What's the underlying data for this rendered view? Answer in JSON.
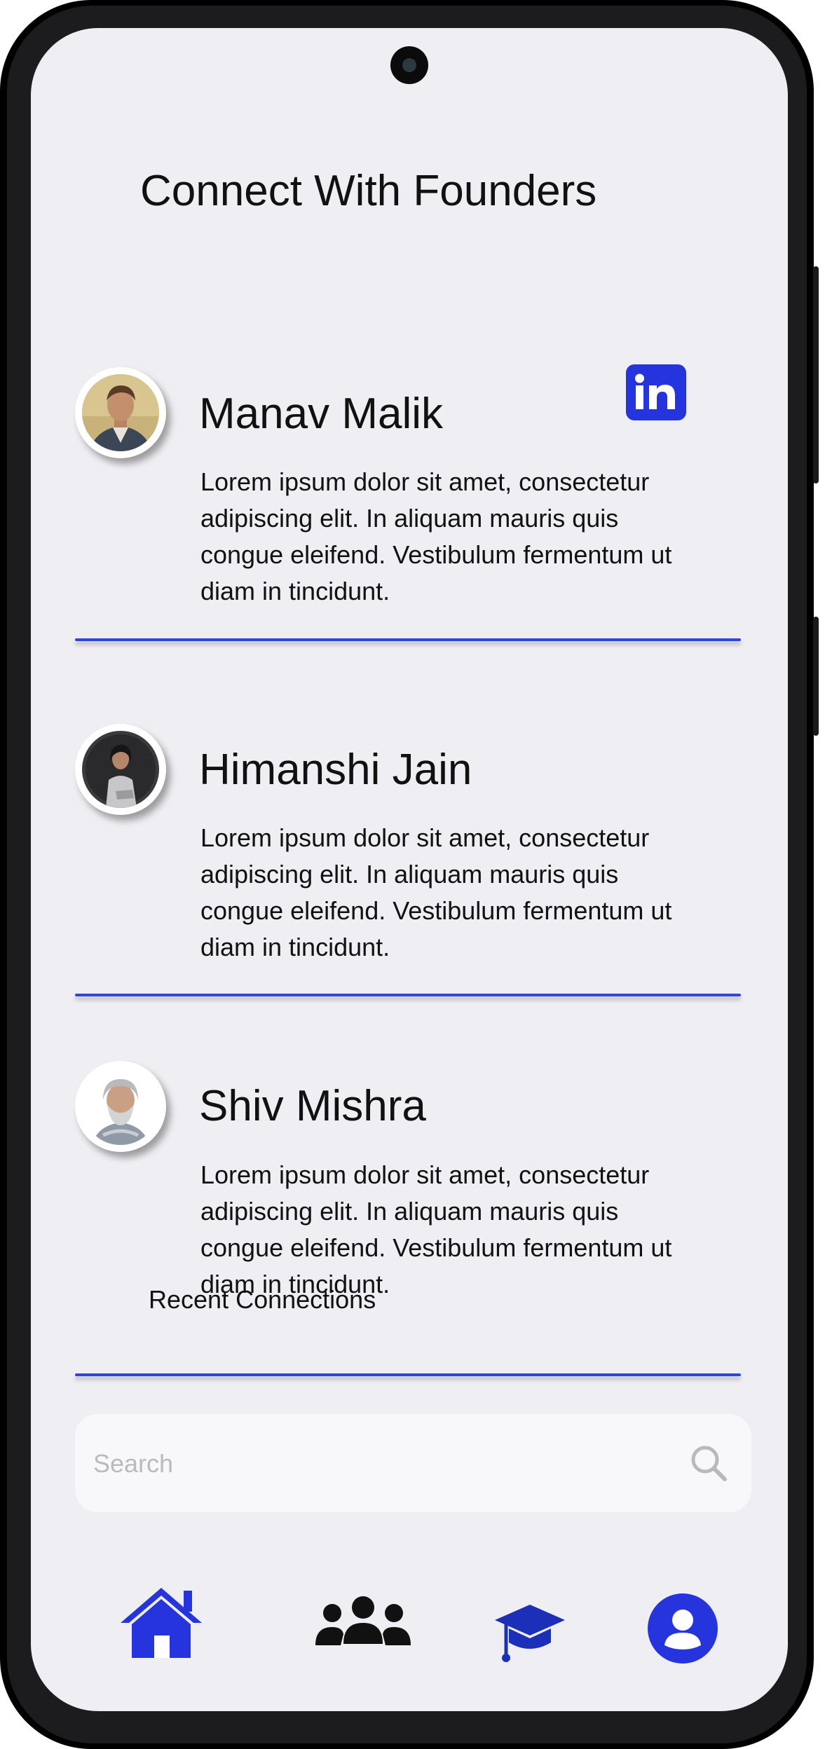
{
  "header": {
    "title": "Connect With Founders"
  },
  "founders": [
    {
      "name": "Manav Malik",
      "bio": "Lorem ipsum dolor sit amet, consectetur adipiscing elit. In aliquam mauris quis congue eleifend. Vestibulum fermentum ut diam in tincidunt.",
      "link_icon": "linkedin-icon"
    },
    {
      "name": "Himanshi Jain",
      "bio": "Lorem ipsum dolor sit amet, consectetur adipiscing elit. In aliquam mauris quis congue eleifend. Vestibulum fermentum ut diam in tincidunt."
    },
    {
      "name": "Shiv Mishra",
      "bio": "Lorem ipsum dolor sit amet, consectetur adipiscing elit. In aliquam mauris quis congue eleifend. Vestibulum fermentum ut diam in tincidunt."
    }
  ],
  "recent": {
    "label": "Recent Connections"
  },
  "search": {
    "placeholder": "Search"
  },
  "nav": {
    "items": [
      {
        "icon": "home-icon"
      },
      {
        "icon": "people-icon"
      },
      {
        "icon": "graduation-cap-icon"
      },
      {
        "icon": "profile-icon"
      }
    ]
  },
  "colors": {
    "accent": "#2f47d4",
    "background": "#efeff3",
    "text": "#111111"
  }
}
